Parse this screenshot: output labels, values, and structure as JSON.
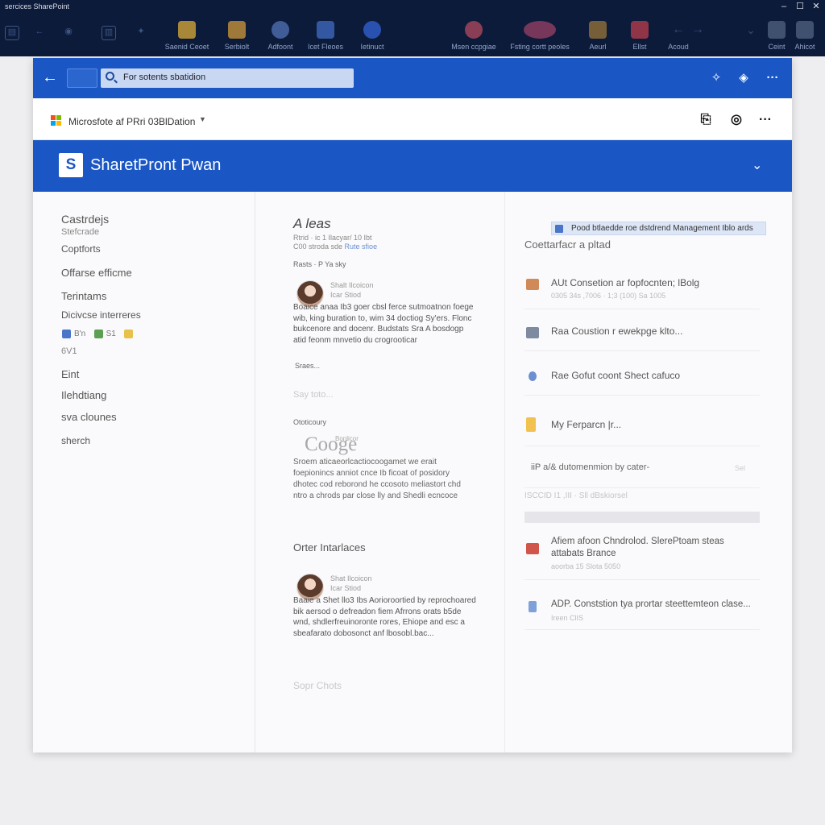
{
  "window": {
    "title": "sercices SharePoint"
  },
  "taskbar": {
    "items": [
      "Saenid Ceoet",
      "Serbiolt",
      "Adfoont",
      "Icet Fleoes",
      "Ietinuct",
      "Msen ccpgiae",
      "Fsting cortt peoles",
      "Aeurl",
      "Ellst",
      "Acoud",
      "Ceint",
      "Ahicot"
    ]
  },
  "addressbar": {
    "search_text": "For sotents sbatidion"
  },
  "brandbar": {
    "org_name": "Microsfote af PRri 03BlDation"
  },
  "site": {
    "logo_letter": "S",
    "title": "SharetPront Pwan"
  },
  "leftnav": {
    "heading": "Castrdejs",
    "sub": "Stefcrade",
    "items": [
      "Coptforts",
      "Offarse efficme",
      "Terintams",
      "Dicivcse interreres"
    ],
    "icon_labels": [
      "B'n",
      "S1"
    ],
    "small": "6V1",
    "items2": [
      "Eint",
      "Ilehdtiang",
      "sva clounes",
      "sherch"
    ]
  },
  "middle": {
    "heading": "A leas",
    "sub1": "Rtrid  ·  ic 1 Ilacyar/ 10 Ibt",
    "sub2_prefix": "C00 stroda sde ",
    "sub2_link": "Rute sfioe",
    "tag": "Rasts  ·  P  Ya sky",
    "post1": {
      "name": "Shalt Ilcoicon",
      "sub": "Icar Stiod",
      "body": "Boaice anaa Ib3 goer cbsl ferce sutmoatnon foege wib, king buration to, wim 34 doctiog Sy'ers. Flonc bukcenore and docenr. Budstats Sra A bosdogp atid feonm mnvetio du crogrooticar",
      "more": "Sraes..."
    },
    "faint1": "Say toto...",
    "google_label": "Ototicoury",
    "google_logo": "Cooge",
    "google_top": "Bonlicor",
    "google_body": "Sroem aticaeorlcactiocoogamet we erait foepionincs anniot cnce Ib ficoat of posidory dhotec cod reborond he ccosoto meliastort chd ntro a chrods par close lly and Shedli ecncoce",
    "other_heading": "Orter Intarlaces",
    "post2": {
      "name": "Shat Ilcoicon",
      "sub": "Icar Stiod",
      "body": "Baaie a Shet llo3 Ibs Aorioroortied by reprochoared bik aersod o defreadon fiem Afrrons orats b5de wnd, shdlerfreuinoronte rores, Ehiope and esc a sbeafarato dobosonct anf lbosobl.bac..."
    },
    "faint2": "Sopr Chots"
  },
  "right": {
    "callout": "Pood btlaedde roe dstdrend Management Iblo ards",
    "heading": "Coettarfacr a pltad",
    "items": [
      {
        "title": "AUt Consetion ar fopfocnten; lBolg",
        "sub": "0305 34s ,7006  ·  1;3 (100) Sa 1005",
        "right": "",
        "color": "#d08a5a"
      },
      {
        "title": "Raa Coustion r ewekpge klto...",
        "sub": "",
        "right": "",
        "color": "#7d8aa0"
      },
      {
        "title": "Rae Gofut coont Shect cafuco",
        "sub": "",
        "right": "",
        "color": "#6b8fd0"
      },
      {
        "title": "My Ferparcn |r...",
        "sub": "",
        "right": "",
        "color": "#f1c24f"
      },
      {
        "title": "iiP a/& dutomenmion by cater-",
        "sub": "",
        "right": "Sel",
        "color": "#d9d9dd"
      }
    ],
    "sep_text": "ISCCID I1 ,III  ·  Sll dBskiorsel",
    "items2": [
      {
        "title": "Afiem afoon Chndrolod. SlerePtoam steas",
        "title2": "attabats Brance",
        "sub": "aoorba 15 Slota 5050",
        "color": "#d0554a"
      },
      {
        "title": "ADP. Conststion tya prortar steettemteon clase...",
        "title2": "",
        "sub": "Ireen ClIS",
        "color": "#7fa1d8"
      }
    ]
  },
  "colors": {
    "brand_blue": "#1a56c4",
    "titlebar": "#0d1b3a"
  },
  "icons": [
    "back-arrow-icon",
    "search-icon",
    "share-icon",
    "reading-icon",
    "more-icon",
    "clipboard-icon",
    "chat-icon",
    "chevron-down-icon",
    "microsoft-logo-icon",
    "sharepoint-logo-icon"
  ]
}
